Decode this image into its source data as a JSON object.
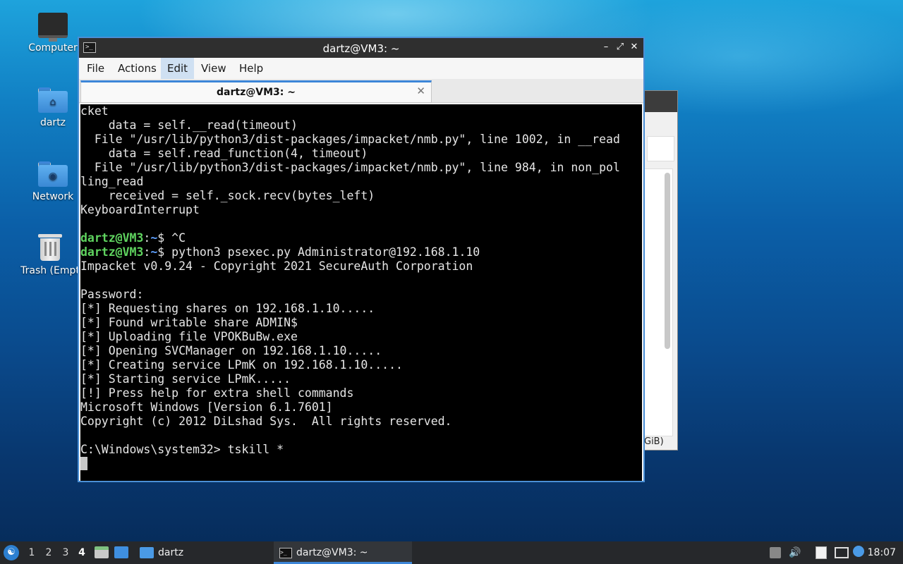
{
  "desktop": {
    "icons": [
      {
        "label": "Computer"
      },
      {
        "label": "dartz"
      },
      {
        "label": "Network"
      },
      {
        "label": "Trash (Empt"
      }
    ]
  },
  "background_window": {
    "size_fragment": "GiB)"
  },
  "terminal_window": {
    "title": "dartz@VM3: ~",
    "app_icon_glyph": ">_",
    "buttons": {
      "minimize": "–",
      "maximize": "⤢",
      "close": "✕"
    },
    "menu": [
      "File",
      "Actions",
      "Edit",
      "View",
      "Help"
    ],
    "active_menu": "Edit",
    "tab": {
      "label": "dartz@VM3: ~",
      "close": "✕"
    },
    "prompt": {
      "user_host": "dartz@VM3",
      "separator": ":",
      "path": "~",
      "suffix": "$"
    },
    "lines": [
      {
        "text": "cket"
      },
      {
        "text": "    data = self.__read(timeout)"
      },
      {
        "text": "  File \"/usr/lib/python3/dist-packages/impacket/nmb.py\", line 1002, in __read"
      },
      {
        "text": "    data = self.read_function(4, timeout)"
      },
      {
        "text": "  File \"/usr/lib/python3/dist-packages/impacket/nmb.py\", line 984, in non_pol"
      },
      {
        "text": "ling_read"
      },
      {
        "text": "    received = self._sock.recv(bytes_left)"
      },
      {
        "text": "KeyboardInterrupt"
      },
      {
        "text": ""
      },
      {
        "text": " ^C",
        "prompt": true
      },
      {
        "text": " python3 psexec.py Administrator@192.168.1.10",
        "prompt": true
      },
      {
        "text": "Impacket v0.9.24 - Copyright 2021 SecureAuth Corporation"
      },
      {
        "text": ""
      },
      {
        "text": "Password:"
      },
      {
        "text": "[*] Requesting shares on 192.168.1.10....."
      },
      {
        "text": "[*] Found writable share ADMIN$"
      },
      {
        "text": "[*] Uploading file VPOKBuBw.exe"
      },
      {
        "text": "[*] Opening SVCManager on 192.168.1.10....."
      },
      {
        "text": "[*] Creating service LPmK on 192.168.1.10....."
      },
      {
        "text": "[*] Starting service LPmK....."
      },
      {
        "text": "[!] Press help for extra shell commands"
      },
      {
        "text": "Microsoft Windows [Version 6.1.7601]"
      },
      {
        "text": "Copyright (c) 2012 DiLshad Sys.  All rights reserved."
      },
      {
        "text": ""
      },
      {
        "text": "C:\\Windows\\system32> tskill *"
      },
      {
        "text": "",
        "cursor": true
      }
    ]
  },
  "taskbar": {
    "start_glyph": "☯",
    "workspaces": [
      "1",
      "2",
      "3",
      "4"
    ],
    "current_workspace": "4",
    "folder_task": "dartz",
    "terminal_task": "dartz@VM3: ~",
    "terminal_task_glyph": ">_",
    "tray": {
      "volume": "🔊"
    },
    "clock": "18:07"
  },
  "colors": {
    "accent": "#3d86d8",
    "prompt_user": "#5fd35f",
    "prompt_path": "#5ea0ff",
    "terminal_bg": "#000000"
  }
}
